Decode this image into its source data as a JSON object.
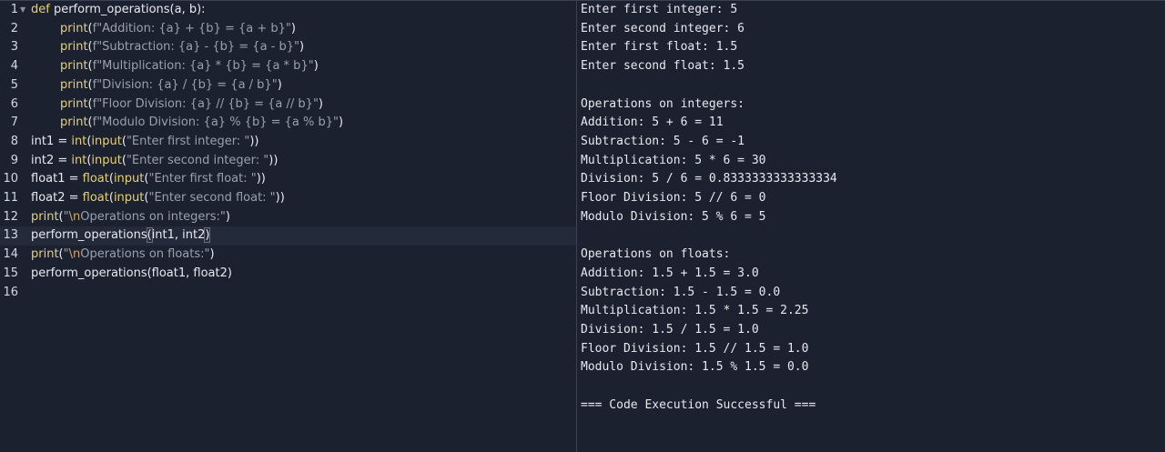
{
  "editor": {
    "line_numbers": [
      "1",
      "2",
      "3",
      "4",
      "5",
      "6",
      "7",
      "8",
      "9",
      "10",
      "11",
      "12",
      "13",
      "14",
      "15",
      "16"
    ],
    "active_line": 13,
    "code": {
      "l1_kw": "def",
      "l1_rest": " perform_operations(a, b):",
      "l2_fn": "print",
      "l2_open": "(",
      "l2_str": "f\"Addition: {a} + {b} = {a + b}\"",
      "l2_close": ")",
      "l3_fn": "print",
      "l3_open": "(",
      "l3_str": "f\"Subtraction: {a} - {b} = {a - b}\"",
      "l3_close": ")",
      "l4_fn": "print",
      "l4_open": "(",
      "l4_str": "f\"Multiplication: {a} * {b} = {a * b}\"",
      "l4_close": ")",
      "l5_fn": "print",
      "l5_open": "(",
      "l5_str": "f\"Division: {a} / {b} = {a / b}\"",
      "l5_close": ")",
      "l6_fn": "print",
      "l6_open": "(",
      "l6_str": "f\"Floor Division: {a} // {b} = {a // b}\"",
      "l6_close": ")",
      "l7_fn": "print",
      "l7_open": "(",
      "l7_str": "f\"Modulo Division: {a} % {b} = {a % b}\"",
      "l7_close": ")",
      "l8_a": "int1 = ",
      "l8_fn1": "int",
      "l8_b": "(",
      "l8_fn2": "input",
      "l8_c": "(",
      "l8_str": "\"Enter first integer: \"",
      "l8_d": "))",
      "l9_a": "int2 = ",
      "l9_fn1": "int",
      "l9_b": "(",
      "l9_fn2": "input",
      "l9_c": "(",
      "l9_str": "\"Enter second integer: \"",
      "l9_d": "))",
      "l10_a": "float1 = ",
      "l10_fn1": "float",
      "l10_b": "(",
      "l10_fn2": "input",
      "l10_c": "(",
      "l10_str": "\"Enter first float: \"",
      "l10_d": "))",
      "l11_a": "float2 = ",
      "l11_fn1": "float",
      "l11_b": "(",
      "l11_fn2": "input",
      "l11_c": "(",
      "l11_str": "\"Enter second float: \"",
      "l11_d": "))",
      "l12_fn": "print",
      "l12_open": "(",
      "l12_str1": "\"",
      "l12_esc": "\\n",
      "l12_str2": "Operations on integers:\"",
      "l12_close": ")",
      "l13_a": "perform_operations",
      "l13_open": "(",
      "l13_b": "int1, int2",
      "l13_close": ")",
      "l14_fn": "print",
      "l14_open": "(",
      "l14_str1": "\"",
      "l14_esc": "\\n",
      "l14_str2": "Operations on floats:\"",
      "l14_close": ")",
      "l15": "perform_operations(float1, float2)"
    }
  },
  "output": {
    "lines": [
      "Enter first integer: 5",
      "Enter second integer: 6",
      "Enter first float: 1.5",
      "Enter second float: 1.5",
      "",
      "Operations on integers:",
      "Addition: 5 + 6 = 11",
      "Subtraction: 5 - 6 = -1",
      "Multiplication: 5 * 6 = 30",
      "Division: 5 / 6 = 0.8333333333333334",
      "Floor Division: 5 // 6 = 0",
      "Modulo Division: 5 % 6 = 5",
      "",
      "Operations on floats:",
      "Addition: 1.5 + 1.5 = 3.0",
      "Subtraction: 1.5 - 1.5 = 0.0",
      "Multiplication: 1.5 * 1.5 = 2.25",
      "Division: 1.5 / 1.5 = 1.0",
      "Floor Division: 1.5 // 1.5 = 1.0",
      "Modulo Division: 1.5 % 1.5 = 0.0",
      "",
      "=== Code Execution Successful ==="
    ]
  }
}
